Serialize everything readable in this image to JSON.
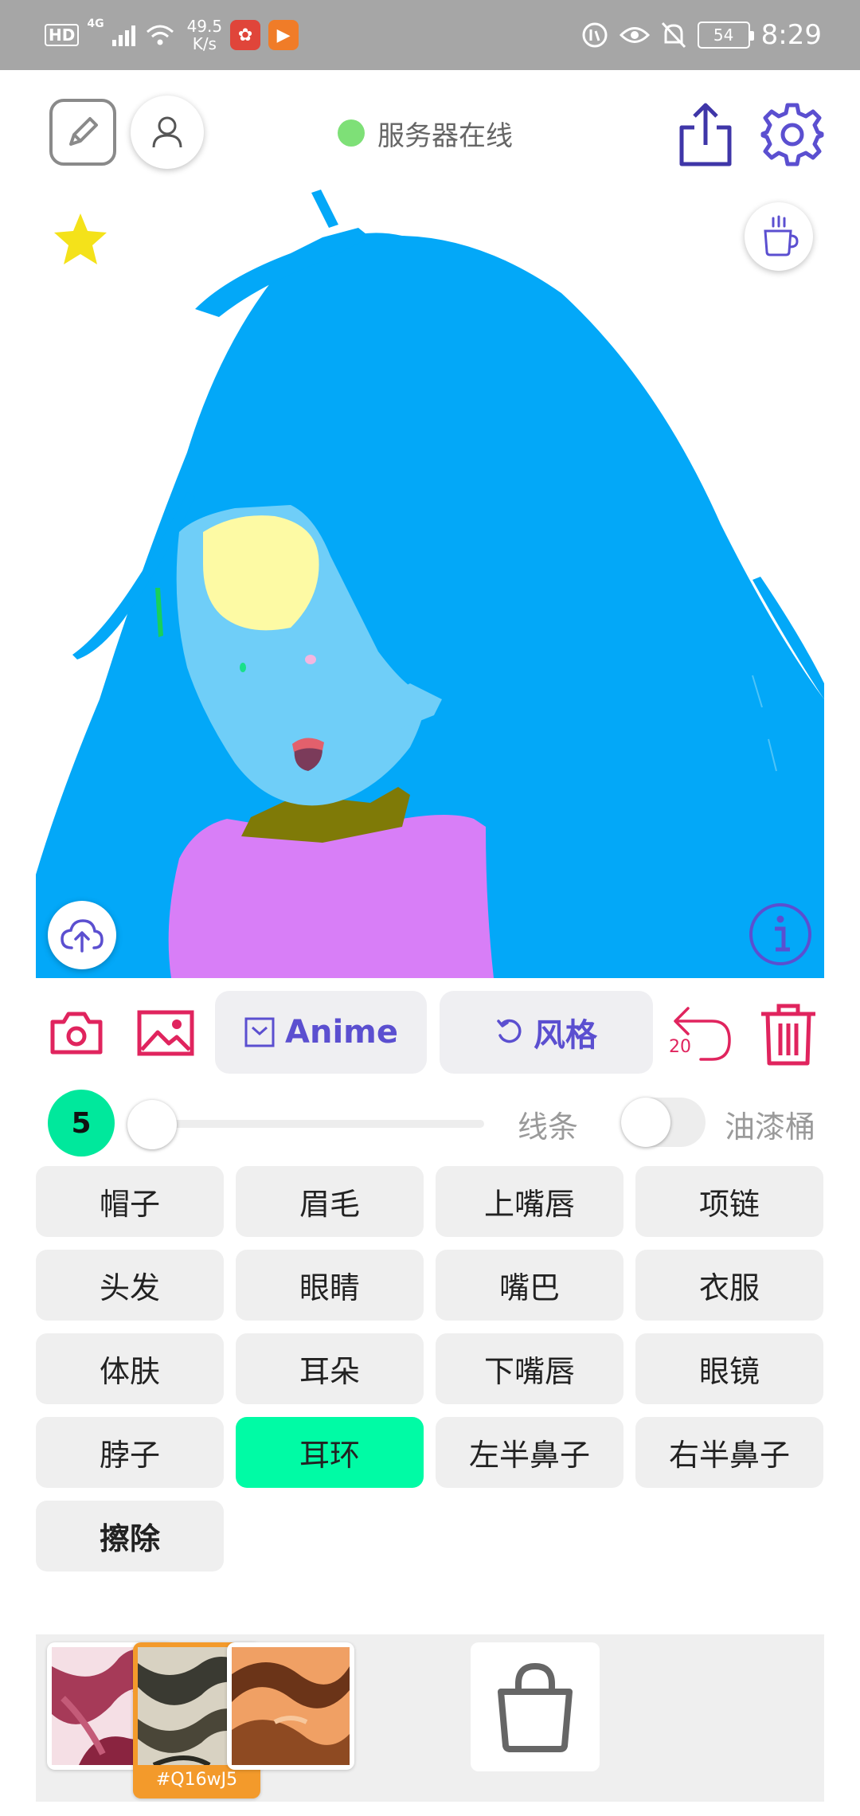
{
  "status_bar": {
    "hd": "HD",
    "network": "4G",
    "speed_value": "49.5",
    "speed_unit": "K/s",
    "battery": "54",
    "time": "8:29"
  },
  "header": {
    "server_status": "服务器在线",
    "server_status_color": "#7ee077",
    "accent_color": "#5b4fd0",
    "icons": [
      "edit-icon",
      "user-icon",
      "share-icon",
      "settings-icon"
    ]
  },
  "canvas": {
    "background": "#ffffff",
    "icons": [
      "star-icon",
      "coffee-icon",
      "cloud-upload-icon",
      "info-icon"
    ],
    "palette": {
      "hair": "#03a8f8",
      "skin": "#6fcef8",
      "highlight": "#fdfaa4",
      "neck": "#7f7a07",
      "clothes": "#d87ef7",
      "mouth": "#e2606c",
      "earring": "#19d05a"
    }
  },
  "toolbar": {
    "anime_label": "Anime",
    "style_label": "风格",
    "undo_count": "20",
    "danger_color": "#e0245e",
    "icons": [
      "camera-icon",
      "image-icon",
      "anime-icon",
      "style-refresh-icon",
      "undo-icon",
      "trash-icon"
    ]
  },
  "brush": {
    "size": "5",
    "size_fraction": 0.0,
    "line_label": "线条",
    "bucket_label": "油漆桶",
    "bucket_enabled": false,
    "badge_color": "#00e89c"
  },
  "parts": [
    {
      "label": "帽子",
      "active": false
    },
    {
      "label": "眉毛",
      "active": false
    },
    {
      "label": "上嘴唇",
      "active": false
    },
    {
      "label": "项链",
      "active": false
    },
    {
      "label": "头发",
      "active": false
    },
    {
      "label": "眼睛",
      "active": false
    },
    {
      "label": "嘴巴",
      "active": false
    },
    {
      "label": "衣服",
      "active": false
    },
    {
      "label": "体肤",
      "active": false
    },
    {
      "label": "耳朵",
      "active": false
    },
    {
      "label": "下嘴唇",
      "active": false
    },
    {
      "label": "眼镜",
      "active": false
    },
    {
      "label": "脖子",
      "active": false
    },
    {
      "label": "耳环",
      "active": true
    },
    {
      "label": "左半鼻子",
      "active": false
    },
    {
      "label": "右半鼻子",
      "active": false
    },
    {
      "label": "擦除",
      "active": false
    }
  ],
  "styles": {
    "selected_code": "#Q16wJ5",
    "selected_index": 1,
    "icons": [
      "bag-icon"
    ]
  }
}
